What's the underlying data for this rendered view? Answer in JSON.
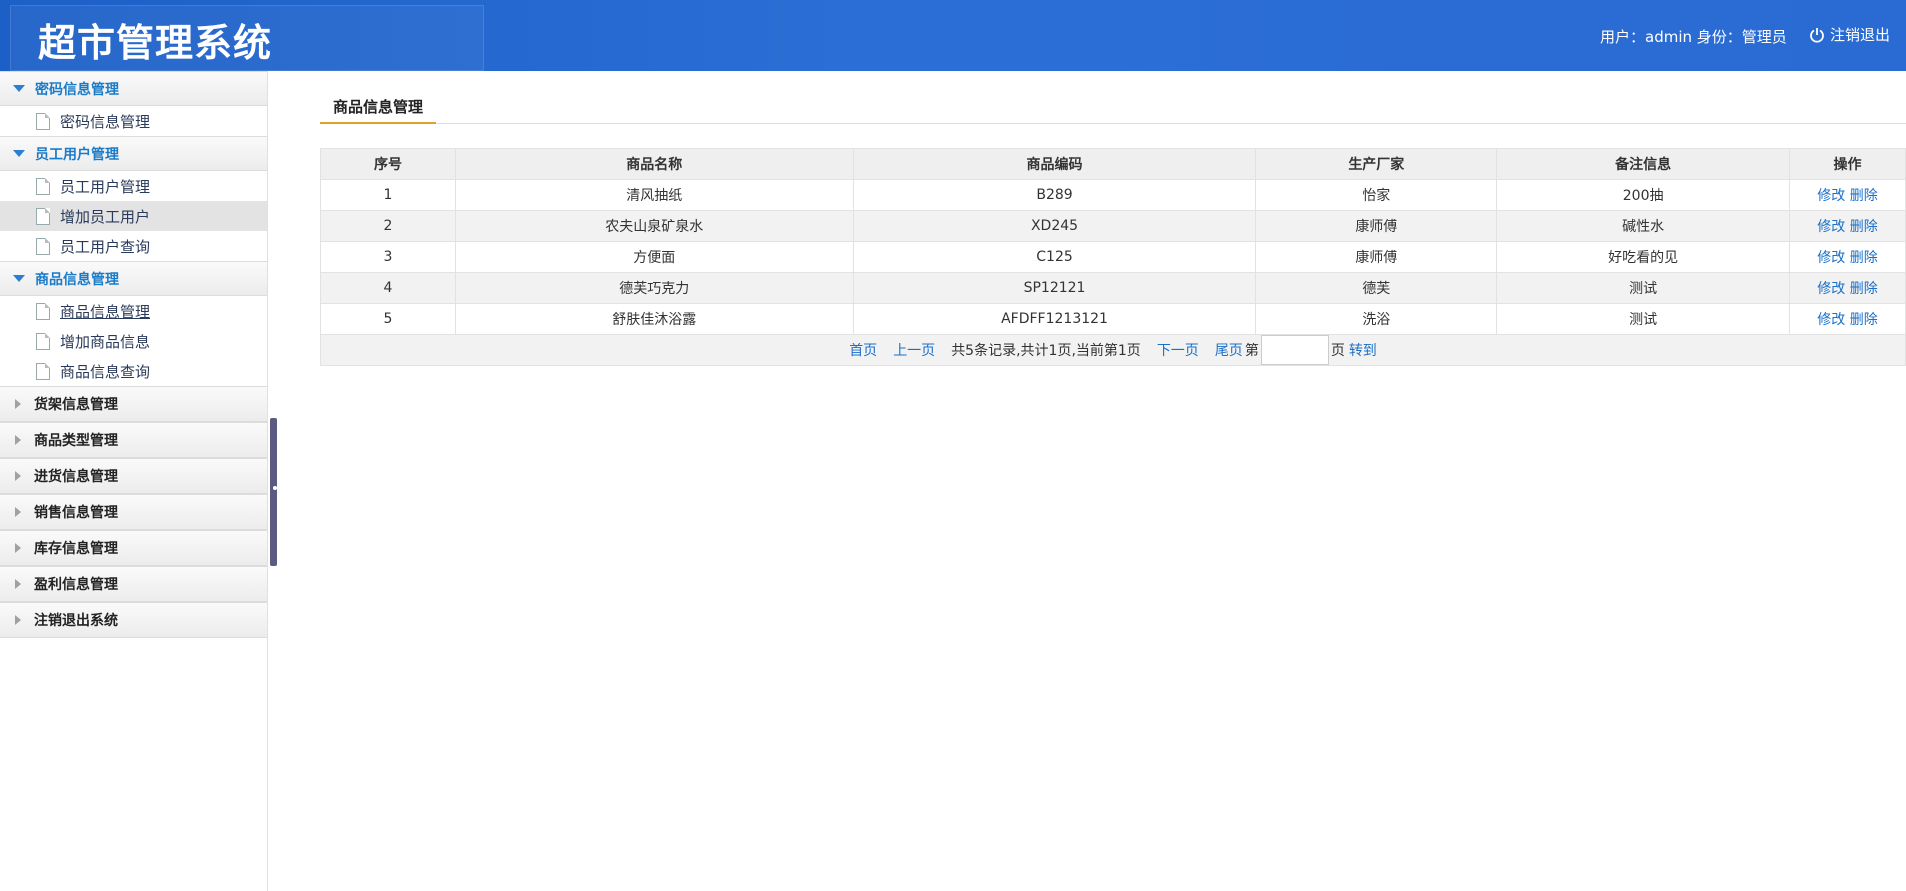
{
  "header": {
    "title": "超市管理系统",
    "user_info": "用户：admin 身份：管理员",
    "logout_label": "注销退出"
  },
  "sidebar": {
    "groups": [
      {
        "label": "密码信息管理",
        "items": [
          "密码信息管理"
        ]
      },
      {
        "label": "员工用户管理",
        "items": [
          "员工用户管理",
          "增加员工用户",
          "员工用户查询"
        ]
      },
      {
        "label": "商品信息管理",
        "items": [
          "商品信息管理",
          "增加商品信息",
          "商品信息查询"
        ]
      },
      {
        "label": "货架信息管理"
      },
      {
        "label": "商品类型管理"
      },
      {
        "label": "进货信息管理"
      },
      {
        "label": "销售信息管理"
      },
      {
        "label": "库存信息管理"
      },
      {
        "label": "盈利信息管理"
      },
      {
        "label": "注销退出系统"
      }
    ]
  },
  "main": {
    "tab": "商品信息管理",
    "columns": [
      "序号",
      "商品名称",
      "商品编码",
      "生产厂家",
      "备注信息",
      "操作"
    ],
    "rows": [
      [
        "1",
        "清风抽纸",
        "B289",
        "怡家",
        "200抽"
      ],
      [
        "2",
        "农夫山泉矿泉水",
        "XD245",
        "康师傅",
        "碱性水"
      ],
      [
        "3",
        "方便面",
        "C125",
        "康师傅",
        "好吃看的见"
      ],
      [
        "4",
        "德芙巧克力",
        "SP12121",
        "德芙",
        "测试"
      ],
      [
        "5",
        "舒肤佳沐浴露",
        "AFDFF1213121",
        "洗浴",
        "测试"
      ]
    ],
    "edit_label": "修改",
    "delete_label": "删除",
    "pager": {
      "first": "首页",
      "prev": "上一页",
      "info": "共5条记录,共计1页,当前第1页",
      "next": "下一页",
      "last": "尾页",
      "goto_prefix": "第",
      "goto_suffix": "页",
      "goto_button": "转到",
      "page_input_value": ""
    }
  }
}
